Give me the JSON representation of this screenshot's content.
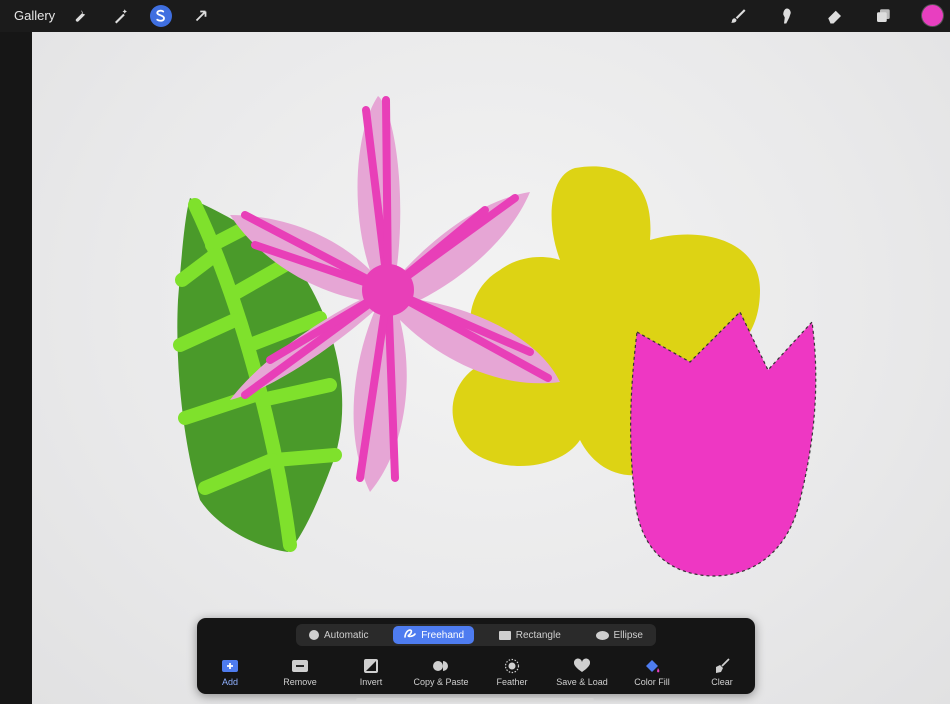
{
  "topbar": {
    "gallery_label": "Gallery",
    "tools_left": [
      "wrench-icon",
      "magic-wand-icon",
      "selection-icon",
      "transform-arrow-icon"
    ],
    "tools_right": [
      "brush-icon",
      "smudge-icon",
      "eraser-icon",
      "layers-icon"
    ],
    "active_tool": "selection-icon",
    "current_color": "#e83fc0"
  },
  "colors": {
    "leaf_dark": "#4a9a2a",
    "leaf_vein": "#7fe12c",
    "petal_light": "#e6a6d5",
    "petal_stripe": "#e83fb8",
    "yellow_flower": "#ddd314",
    "tulip": "#ee37c3"
  },
  "selection_panel": {
    "modes": [
      {
        "label": "Automatic",
        "icon": "circle-icon"
      },
      {
        "label": "Freehand",
        "icon": "freehand-icon",
        "active": true
      },
      {
        "label": "Rectangle",
        "icon": "rectangle-icon"
      },
      {
        "label": "Ellipse",
        "icon": "ellipse-icon"
      }
    ],
    "actions": [
      {
        "label": "Add",
        "icon": "add-icon",
        "highlight": true
      },
      {
        "label": "Remove",
        "icon": "remove-icon"
      },
      {
        "label": "Invert",
        "icon": "invert-icon"
      },
      {
        "label": "Copy & Paste",
        "icon": "copy-paste-icon"
      },
      {
        "label": "Feather",
        "icon": "feather-icon"
      },
      {
        "label": "Save & Load",
        "icon": "heart-icon"
      },
      {
        "label": "Color Fill",
        "icon": "color-fill-icon",
        "highlight": true
      },
      {
        "label": "Clear",
        "icon": "clear-broom-icon"
      }
    ]
  }
}
